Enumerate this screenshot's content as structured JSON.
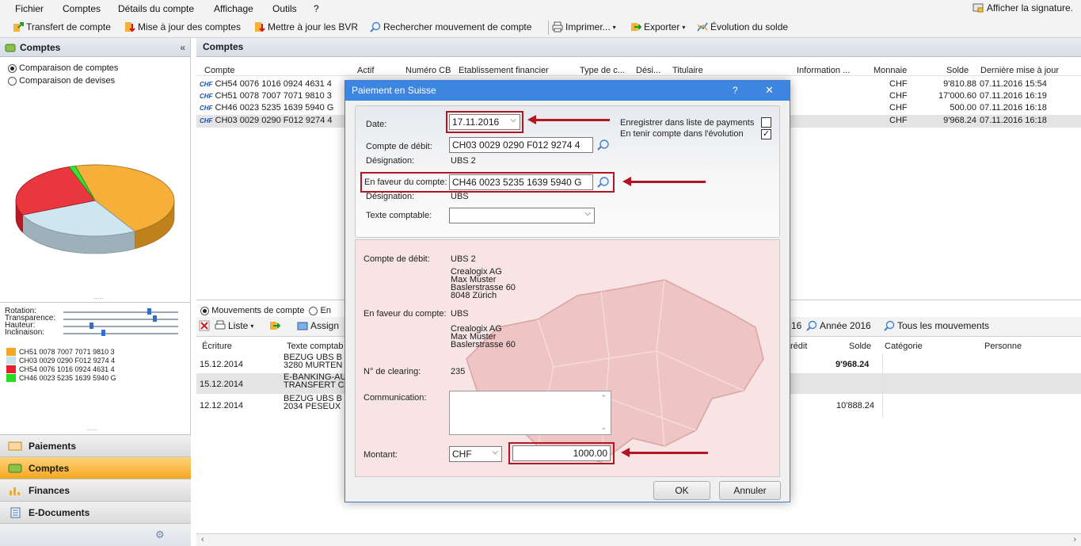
{
  "menu": {
    "items": [
      "Fichier",
      "Comptes",
      "Détails du compte",
      "Affichage",
      "Outils",
      "?"
    ],
    "signature": "Afficher la signature."
  },
  "toolbar": {
    "transfer": "Transfert de compte",
    "update_accounts": "Mise à jour des comptes",
    "update_bvr": "Mettre à jour les BVR",
    "search_movement": "Rechercher mouvement de compte",
    "print": "Imprimer...",
    "export": "Exporter",
    "balance_evolution": "Évolution du solde"
  },
  "left": {
    "title": "Comptes",
    "options": [
      "Comparaison de comptes",
      "Comparaison de devises"
    ],
    "sliders": [
      "Rotation:",
      "Transparence:",
      "Hauteur:",
      "Inclinaison:"
    ],
    "legend": [
      {
        "label": "CH51 0078 7007 7071 9810 3",
        "color": "#f5a623"
      },
      {
        "label": "CH03 0029 0290 F012 9274 4",
        "color": "#c8e3ee"
      },
      {
        "label": "CH54 0076 1016 0924 4631 4",
        "color": "#e8202a"
      },
      {
        "label": "CH46 0023 5235 1639 5940 G",
        "color": "#22dd22"
      }
    ],
    "nav": [
      "Paiements",
      "Comptes",
      "Finances",
      "E-Documents"
    ]
  },
  "grid": {
    "title": "Comptes",
    "columns": [
      "Compte",
      "Actif",
      "Numéro CB",
      "Etablissement financier",
      "Type de c...",
      "Dési...",
      "Titulaire",
      "Information ...",
      "Monnaie",
      "Solde",
      "Dernière mise à jour"
    ],
    "currency_badge": "CHF",
    "rows": [
      {
        "account": "CH54 0076 1016 0924 4631 4",
        "currency": "CHF",
        "balance": "9'810.88",
        "updated": "07.11.2016 15:54"
      },
      {
        "account": "CH51 0078 7007 7071 9810 3",
        "currency": "CHF",
        "balance": "17'000.60",
        "updated": "07.11.2016 16:19"
      },
      {
        "account": "CH46 0023 5235 1639 5940 G",
        "currency": "CHF",
        "balance": "500.00",
        "updated": "07.11.2016 16:18"
      },
      {
        "account": "CH03 0029 0290 F012 9274 4",
        "currency": "CHF",
        "balance": "9'968.24",
        "updated": "07.11.2016 16:18"
      }
    ]
  },
  "movements": {
    "radio_movements": "Mouvements de compte",
    "radio_other": "En",
    "list_btn": "Liste",
    "assign_btn": "Assign",
    "period_prev": "16",
    "year_btn": "Année 2016",
    "all_btn": "Tous les mouvements",
    "columns": [
      "Écriture",
      "Texte comptab",
      "rédit",
      "Solde",
      "Catégorie",
      "Personne"
    ],
    "rows": [
      {
        "date": "15.12.2014",
        "text1": "BEZUG UBS B",
        "text2": "3280 MURTEN",
        "balance": "9'968.24"
      },
      {
        "date": "15.12.2014",
        "text1": "E-BANKING-AU",
        "text2": "TRANSFERT C",
        "balance": ""
      },
      {
        "date": "12.12.2014",
        "text1": "BEZUG UBS B",
        "text2": "2034 PESEUX",
        "balance": "10'888.24"
      }
    ]
  },
  "dialog": {
    "title": "Paiement en Suisse",
    "help": "?",
    "close": "✕",
    "date_label": "Date:",
    "date_value": "17.11.2016",
    "save_in_list": "Enregistrer dans liste de payments",
    "consider_evolution": "En tenir compte dans l'évolution",
    "debit_label": "Compte de débit:",
    "debit_value": "CH03 0029 0290 F012 9274 4",
    "designation_label": "Désignation:",
    "debit_designation": "UBS 2",
    "credit_label": "En faveur du compte:",
    "credit_value": "CH46 0023 5235 1639 5940 G",
    "credit_designation": "UBS",
    "booking_text_label": "Texte comptable:",
    "summary": {
      "debit_label": "Compte de débit:",
      "debit_name": "UBS 2",
      "address1": [
        "Crealogix AG",
        "Max Muster",
        "Baslerstrasse 60",
        "8048 Zürich"
      ],
      "credit_label": "En faveur du compte:",
      "credit_name": "UBS",
      "address2": [
        "Crealogix AG",
        "Max Muster",
        "Baslerstrasse 60"
      ],
      "clearing_label": "N° de clearing:",
      "clearing_value": "235",
      "communication_label": "Communication:"
    },
    "amount_label": "Montant:",
    "currency": "CHF",
    "amount": "1000.00",
    "ok": "OK",
    "cancel": "Annuler"
  },
  "chart_data": {
    "type": "pie",
    "categories": [
      "CH51 0078 7007 7071 9810 3",
      "CH03 0029 0290 F012 9274 4",
      "CH54 0076 1016 0924 4631 4",
      "CH46 0023 5235 1639 5940 G"
    ],
    "values": [
      17000.6,
      9968.24,
      9810.88,
      500.0
    ],
    "colors": [
      "#f5a623",
      "#c8e3ee",
      "#e8202a",
      "#22dd22"
    ]
  }
}
